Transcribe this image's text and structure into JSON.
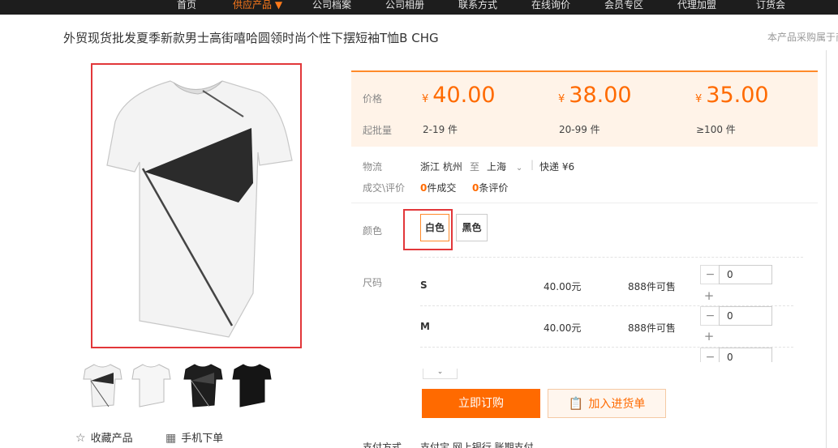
{
  "nav": {
    "items": [
      {
        "label": "首页",
        "active": false
      },
      {
        "label": "供应产品 ▼",
        "active": true
      },
      {
        "label": "公司档案",
        "active": false
      },
      {
        "label": "公司相册",
        "active": false
      },
      {
        "label": "联系方式",
        "active": false
      },
      {
        "label": "在线询价",
        "active": false
      },
      {
        "label": "会员专区",
        "active": false
      },
      {
        "label": "代理加盟",
        "active": false
      },
      {
        "label": "订货会",
        "active": false
      }
    ]
  },
  "product": {
    "title": "外贸现货批发夏季新款男士高街嘻哈圆领时尚个性下摆短袖T恤B CHG",
    "side_note": "本产品采购属于商"
  },
  "price_box": {
    "price_label": "价格",
    "moq_label": "起批量",
    "currency": "¥",
    "tiers": [
      {
        "price": "40.00",
        "range": "2-19 件"
      },
      {
        "price": "38.00",
        "range": "20-99 件"
      },
      {
        "price": "35.00",
        "range": "≥100 件"
      }
    ]
  },
  "logistics": {
    "label": "物流",
    "from": "浙江 杭州",
    "to_word": "至",
    "to": "上海",
    "express": "快递 ¥6"
  },
  "deals": {
    "label": "成交\\评价",
    "sold_count": "0",
    "sold_text": "件成交",
    "review_count": "0",
    "review_text": "条评价"
  },
  "color": {
    "label": "颜色",
    "options": [
      "白色",
      "黑色"
    ],
    "selected": "白色"
  },
  "size": {
    "label": "尺码",
    "rows": [
      {
        "name": "S",
        "price": "40.00元",
        "stock": "888件可售",
        "qty": "0"
      },
      {
        "name": "M",
        "price": "40.00元",
        "stock": "888件可售",
        "qty": "0"
      },
      {
        "name": "",
        "price": "",
        "stock": "",
        "qty": "0"
      }
    ]
  },
  "actions": {
    "buy": "立即订购",
    "add_cart": "加入进货单",
    "favorite": "收藏产品",
    "mobile_order": "手机下单"
  },
  "payment": {
    "label": "支付方式",
    "methods": "支付宝   网上银行   账期支付"
  },
  "icons": {
    "favorite": "star-icon",
    "mobile": "qrcode-icon",
    "cart": "clipboard-icon",
    "expand": "chevron-down-icon"
  },
  "colors": {
    "accent": "#ff6a00",
    "highlight_frame": "#e2373a",
    "price_bg": "#fff3e8",
    "nav_bg": "#1d1d1d"
  }
}
